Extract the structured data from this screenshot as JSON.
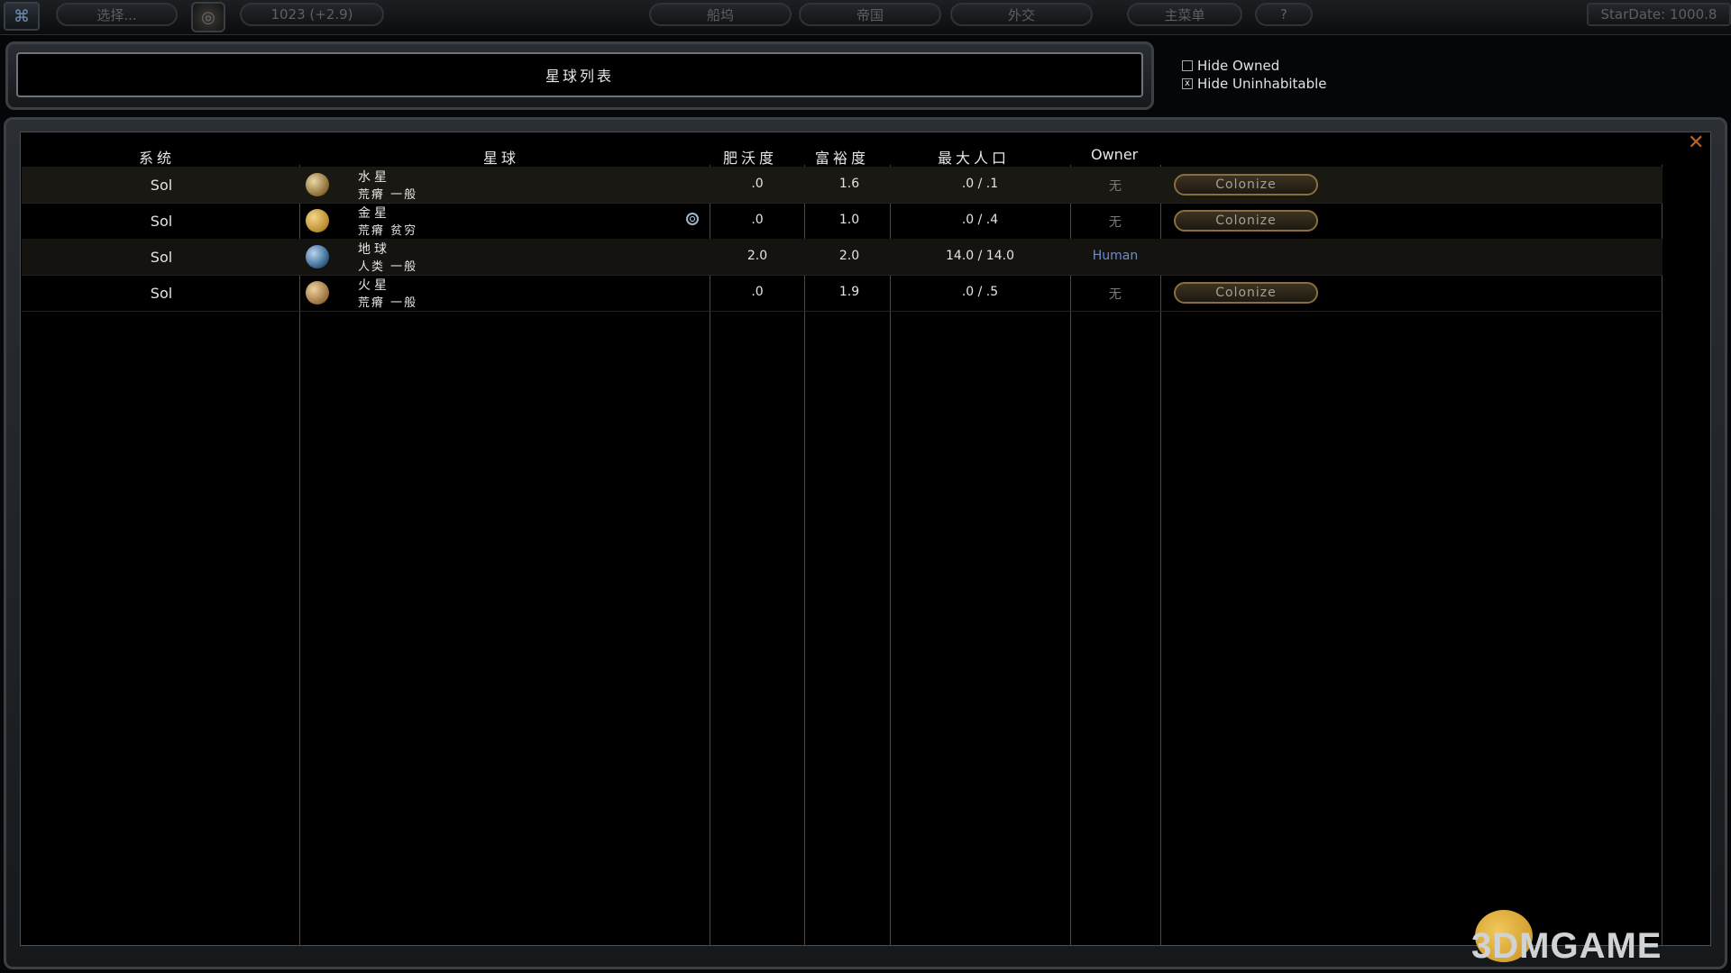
{
  "topbar": {
    "select_label": "选择...",
    "credits": "1023 (+2.9)",
    "nav": [
      "船坞",
      "帝国",
      "外交"
    ],
    "main_menu": "主菜单",
    "help": "?",
    "stardate": "StarDate: 1000.8"
  },
  "panel": {
    "title": "星球列表",
    "hide_owned": {
      "label": "Hide Owned",
      "checked": false
    },
    "hide_uninhabitable": {
      "label": "Hide Uninhabitable",
      "checked": true,
      "mark": "x"
    }
  },
  "table": {
    "headers": [
      "系统",
      "星球",
      "肥沃度",
      "富裕度",
      "最大人口",
      "Owner"
    ],
    "rows": [
      {
        "system": "Sol",
        "planet": "水星",
        "desc": "荒瘠 一般",
        "fertility": ".0",
        "richness": "1.6",
        "maxpop": ".0 / .1",
        "owner": "无",
        "action": "Colonize"
      },
      {
        "system": "Sol",
        "planet": "金星",
        "desc": "荒瘠 贫穷",
        "fertility": ".0",
        "richness": "1.0",
        "maxpop": ".0 / .4",
        "owner": "无",
        "action": "Colonize"
      },
      {
        "system": "Sol",
        "planet": "地球",
        "desc": "人类 一般",
        "fertility": "2.0",
        "richness": "2.0",
        "maxpop": "14.0 / 14.0",
        "owner": "Human",
        "action": ""
      },
      {
        "system": "Sol",
        "planet": "火星",
        "desc": "荒瘠 一般",
        "fertility": ".0",
        "richness": "1.9",
        "maxpop": ".0 / .5",
        "owner": "无",
        "action": "Colonize"
      }
    ]
  },
  "colors": {
    "accent_gold": "#8b6e3d",
    "owner_human": "#6d8fc8",
    "close": "#b7662d"
  },
  "icons": [
    "empire-logo-icon",
    "research-icon",
    "close-icon",
    "planet-icon",
    "swirl-icon"
  ],
  "watermark": "3DMGAME"
}
